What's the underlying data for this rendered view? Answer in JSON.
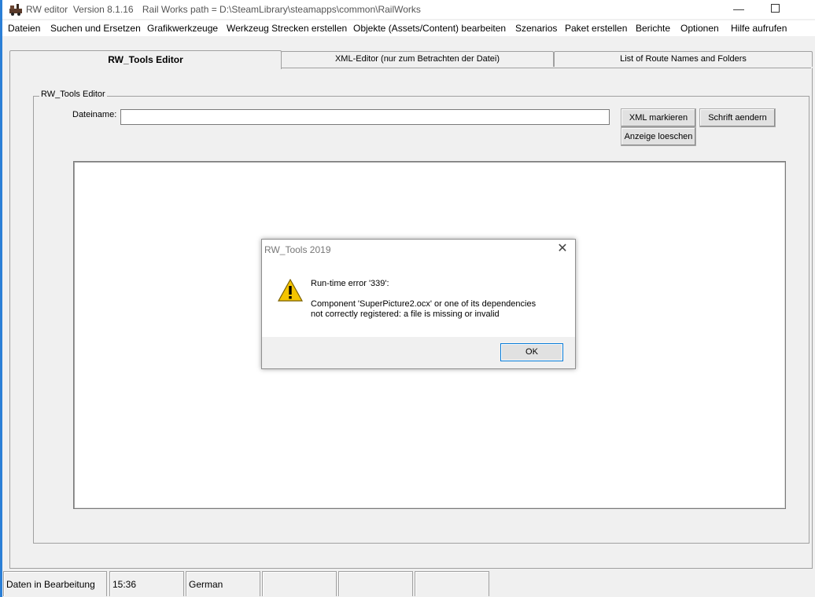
{
  "window": {
    "app_name": "RW editor",
    "version": "Version 8.1.16",
    "path_text": "Rail Works path = D:\\SteamLibrary\\steamapps\\common\\RailWorks",
    "minimize": "—",
    "close": "✕"
  },
  "menu": [
    "Dateien",
    "Suchen und Ersetzen",
    "Grafikwerkzeuge",
    "Werkzeug Strecken erstellen",
    "Objekte (Assets/Content) bearbeiten",
    "Szenarios",
    "Paket erstellen",
    "Berichte",
    "Optionen",
    "Hilfe aufrufen"
  ],
  "tabs": [
    {
      "label": "RW_Tools Editor",
      "active": true
    },
    {
      "label": "XML-Editor (nur zum Betrachten der Datei)",
      "active": false
    },
    {
      "label": "List of Route Names and Folders",
      "active": false
    }
  ],
  "editor_panel": {
    "group_title": "RW_Tools Editor",
    "filename_label": "Dateiname:",
    "filename_value": "",
    "xml_button": "XML markieren",
    "font_button": "Schrift aendern",
    "clear_button": "Anzeige loeschen"
  },
  "status": [
    "Daten in Bearbeitung",
    "15:36",
    "German",
    "",
    "",
    ""
  ],
  "dialog": {
    "title": "RW_Tools 2019",
    "close": "✕",
    "error_title": "Run-time error '339':",
    "error_line1": "Component 'SuperPicture2.ocx' or one of its dependencies",
    "error_line2": "not correctly registered: a file is missing or invalid",
    "ok": "OK"
  },
  "colors": {
    "accent": "#0078d7",
    "warning": "#f5c400"
  }
}
